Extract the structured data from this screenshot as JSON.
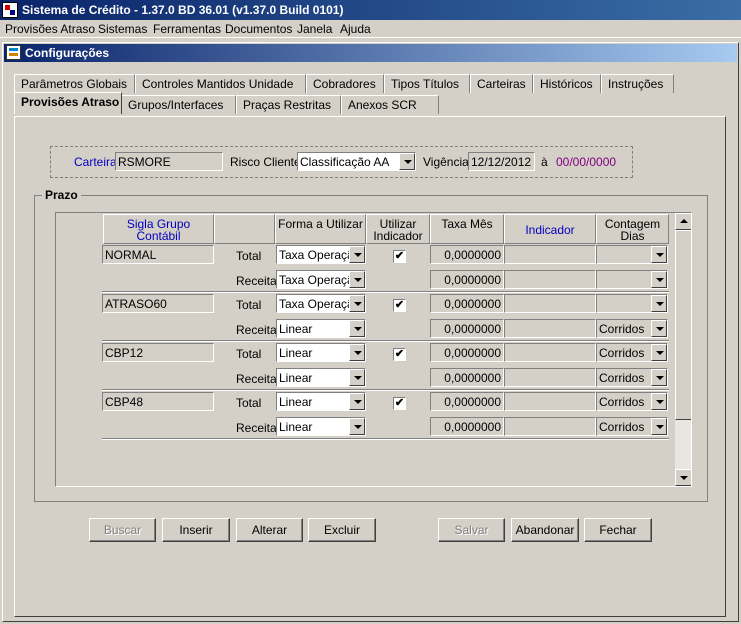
{
  "app": {
    "title": "Sistema de Crédito - 1.37.0 BD 36.01 (v1.37.0 Build 0101)"
  },
  "menu": [
    "Provisões Atraso",
    "Sistemas",
    "Ferramentas",
    "Documentos",
    "Janela",
    "Ajuda"
  ],
  "window": {
    "title": "Configurações"
  },
  "tabs_row1": [
    "Parâmetros Globais",
    "Controles Mantidos Unidade",
    "Cobradores",
    "Tipos Títulos",
    "Carteiras",
    "Históricos",
    "Instruções"
  ],
  "tabs_row2": [
    "Provisões Atraso",
    "Grupos/Interfaces",
    "Praças Restritas",
    "Anexos SCR"
  ],
  "active_tab": "Provisões Atraso",
  "header": {
    "carteira_label": "Carteira",
    "carteira_value": "RSMORE",
    "risco_label": "Risco Cliente",
    "risco_value": "Classificação AA",
    "vigencia_label": "Vigência",
    "vigencia_value": "12/12/2012",
    "a_label": "à",
    "vigencia_end": "00/00/0000"
  },
  "prazo": {
    "title": "Prazo",
    "columns": {
      "sigla": "Sigla Grupo Contábil",
      "forma": "Forma a Utilizar",
      "utilizar": "Utilizar Indicador",
      "taxa": "Taxa Mês",
      "indicador": "Indicador",
      "contagem": "Contagem Dias"
    },
    "groups": [
      {
        "sigla": "NORMAL",
        "rows": [
          {
            "tipo": "Total",
            "forma": "Taxa Operação",
            "utilizar": true,
            "taxa": "0,0000000",
            "indicador": "",
            "contagem": ""
          },
          {
            "tipo": "Receita",
            "forma": "Taxa Operação",
            "utilizar": false,
            "taxa": "0,0000000",
            "indicador": "",
            "contagem": ""
          }
        ]
      },
      {
        "sigla": "ATRASO60",
        "rows": [
          {
            "tipo": "Total",
            "forma": "Taxa Operação",
            "utilizar": true,
            "taxa": "0,0000000",
            "indicador": "",
            "contagem": ""
          },
          {
            "tipo": "Receita",
            "forma": "Linear",
            "utilizar": false,
            "taxa": "0,0000000",
            "indicador": "",
            "contagem": "Corridos"
          }
        ]
      },
      {
        "sigla": "CBP12",
        "rows": [
          {
            "tipo": "Total",
            "forma": "Linear",
            "utilizar": true,
            "taxa": "0,0000000",
            "indicador": "",
            "contagem": "Corridos"
          },
          {
            "tipo": "Receita",
            "forma": "Linear",
            "utilizar": false,
            "taxa": "0,0000000",
            "indicador": "",
            "contagem": "Corridos"
          }
        ]
      },
      {
        "sigla": "CBP48",
        "rows": [
          {
            "tipo": "Total",
            "forma": "Linear",
            "utilizar": true,
            "taxa": "0,0000000",
            "indicador": "",
            "contagem": "Corridos"
          },
          {
            "tipo": "Receita",
            "forma": "Linear",
            "utilizar": false,
            "taxa": "0,0000000",
            "indicador": "",
            "contagem": "Corridos"
          }
        ]
      }
    ]
  },
  "buttons": {
    "buscar": "Buscar",
    "inserir": "Inserir",
    "alterar": "Alterar",
    "excluir": "Excluir",
    "salvar": "Salvar",
    "abandonar": "Abandonar",
    "fechar": "Fechar"
  },
  "icons": {
    "check": "✔"
  }
}
